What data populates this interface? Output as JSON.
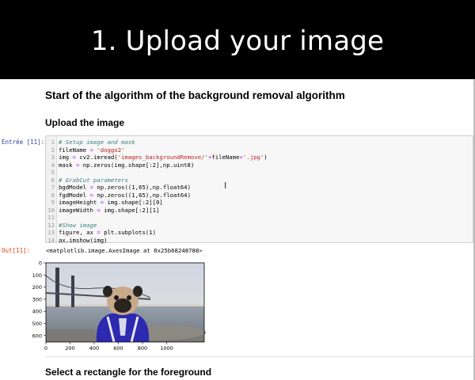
{
  "banner": {
    "title": "1. Upload your image"
  },
  "notebook": {
    "heading": "Start of the algorithm of the background removal algorithm",
    "subheading": "Upload the image",
    "input_prompt": "Entrée [11]:",
    "output_prompt": "Out[11]:",
    "code_lines": [
      {
        "n": "1",
        "parts": [
          {
            "c": "cm",
            "t": "# Setup image and mask"
          }
        ]
      },
      {
        "n": "2",
        "parts": [
          {
            "c": "tx",
            "t": "fileName "
          },
          {
            "c": "op",
            "t": "="
          },
          {
            "c": "st",
            "t": " 'doggo2'"
          }
        ]
      },
      {
        "n": "3",
        "parts": [
          {
            "c": "tx",
            "t": "img "
          },
          {
            "c": "op",
            "t": "="
          },
          {
            "c": "tx",
            "t": " cv2.imread("
          },
          {
            "c": "st",
            "t": "'images_backgroundRemove/'"
          },
          {
            "c": "op",
            "t": "+"
          },
          {
            "c": "tx",
            "t": "fileName"
          },
          {
            "c": "op",
            "t": "+"
          },
          {
            "c": "st",
            "t": "'.jpg'"
          },
          {
            "c": "tx",
            "t": ")"
          }
        ]
      },
      {
        "n": "4",
        "parts": [
          {
            "c": "tx",
            "t": "mask "
          },
          {
            "c": "op",
            "t": "="
          },
          {
            "c": "tx",
            "t": " np.zeros(img.shape[:2],np.uint8)"
          }
        ]
      },
      {
        "n": "5",
        "parts": []
      },
      {
        "n": "6",
        "parts": [
          {
            "c": "cm",
            "t": "# GrabCut parameters"
          }
        ]
      },
      {
        "n": "7",
        "parts": [
          {
            "c": "tx",
            "t": "bgdModel "
          },
          {
            "c": "op",
            "t": "="
          },
          {
            "c": "tx",
            "t": " np.zeros((1,65),np.float64)"
          }
        ]
      },
      {
        "n": "8",
        "parts": [
          {
            "c": "tx",
            "t": "fgdModel "
          },
          {
            "c": "op",
            "t": "="
          },
          {
            "c": "tx",
            "t": " np.zeros((1,65),np.float64)"
          }
        ]
      },
      {
        "n": "9",
        "parts": [
          {
            "c": "tx",
            "t": "imageHeight "
          },
          {
            "c": "op",
            "t": "="
          },
          {
            "c": "tx",
            "t": " img.shape[:2][0]"
          }
        ]
      },
      {
        "n": "10",
        "parts": [
          {
            "c": "tx",
            "t": "imageWidth "
          },
          {
            "c": "op",
            "t": "="
          },
          {
            "c": "tx",
            "t": " img.shape[:2][1]"
          }
        ]
      },
      {
        "n": "11",
        "parts": []
      },
      {
        "n": "12",
        "parts": [
          {
            "c": "cm",
            "t": "#Show image"
          }
        ]
      },
      {
        "n": "13",
        "parts": [
          {
            "c": "tx",
            "t": "figure, ax "
          },
          {
            "c": "op",
            "t": "="
          },
          {
            "c": "tx",
            "t": " plt.subplots(1)"
          }
        ]
      },
      {
        "n": "14",
        "parts": [
          {
            "c": "tx",
            "t": "ax.imshow(img)"
          }
        ]
      }
    ],
    "output_text": "<matplotlib.image.AxesImage at 0x25b68248788>",
    "plot": {
      "y_ticks": [
        "0",
        "100",
        "200",
        "300",
        "400",
        "500",
        "600"
      ],
      "x_ticks": [
        "0",
        "200",
        "400",
        "600",
        "800",
        "1000"
      ]
    },
    "next_heading": "Select a rectangle for the foreground"
  },
  "cursor_glyph": "I"
}
